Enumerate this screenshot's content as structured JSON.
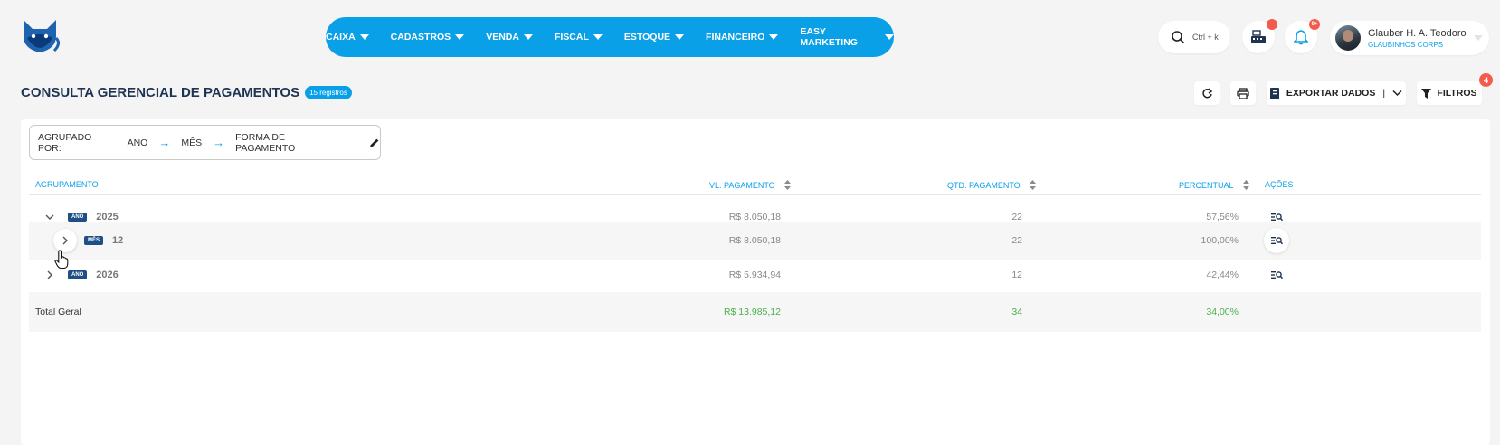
{
  "header": {
    "logo": "fox-logo",
    "nav": [
      {
        "label": "CAIXA"
      },
      {
        "label": "CADASTROS"
      },
      {
        "label": "VENDA"
      },
      {
        "label": "FISCAL"
      },
      {
        "label": "ESTOQUE"
      },
      {
        "label": "FINANCEIRO"
      },
      {
        "label": "EASY MARKETING"
      }
    ],
    "search_shortcut": "Ctrl + k",
    "notifications_badge": "9+",
    "user": {
      "name": "Glauber H. A. Teodoro",
      "company": "GLAUBINHOS CORPS"
    }
  },
  "page": {
    "title": "CONSULTA GERENCIAL DE PAGAMENTOS",
    "count_badge": "15 registros",
    "export_label": "EXPORTAR DADOS",
    "filter_label": "FILTROS",
    "filter_count": "4"
  },
  "grouping": {
    "label": "AGRUPADO POR:",
    "levels": [
      "ANO",
      "MÊS",
      "FORMA DE PAGAMENTO"
    ]
  },
  "table": {
    "columns": {
      "group": "AGRUPAMENTO",
      "amount": "VL. PAGAMENTO",
      "qty": "QTD. PAGAMENTO",
      "percent": "PERCENTUAL",
      "actions": "AÇÕES"
    },
    "rows": [
      {
        "level_tag": "ANO",
        "label": "2025",
        "amount": "R$ 8.050,18",
        "qty": "22",
        "percent": "57,56%",
        "expanded": true
      },
      {
        "level_tag": "MÊS",
        "label": "12",
        "amount": "R$ 8.050,18",
        "qty": "22",
        "percent": "100,00%",
        "expanded": false
      },
      {
        "level_tag": "ANO",
        "label": "2026",
        "amount": "R$ 5.934,94",
        "qty": "12",
        "percent": "42,44%",
        "expanded": false
      }
    ],
    "total": {
      "label": "Total Geral",
      "amount": "R$ 13.985,12",
      "qty": "34",
      "percent": "34,00%"
    }
  },
  "colors": {
    "accent": "#0aa0e8",
    "navy": "#1e4f86",
    "badge_red": "#f25c4a",
    "total_green": "#4cae4c"
  }
}
